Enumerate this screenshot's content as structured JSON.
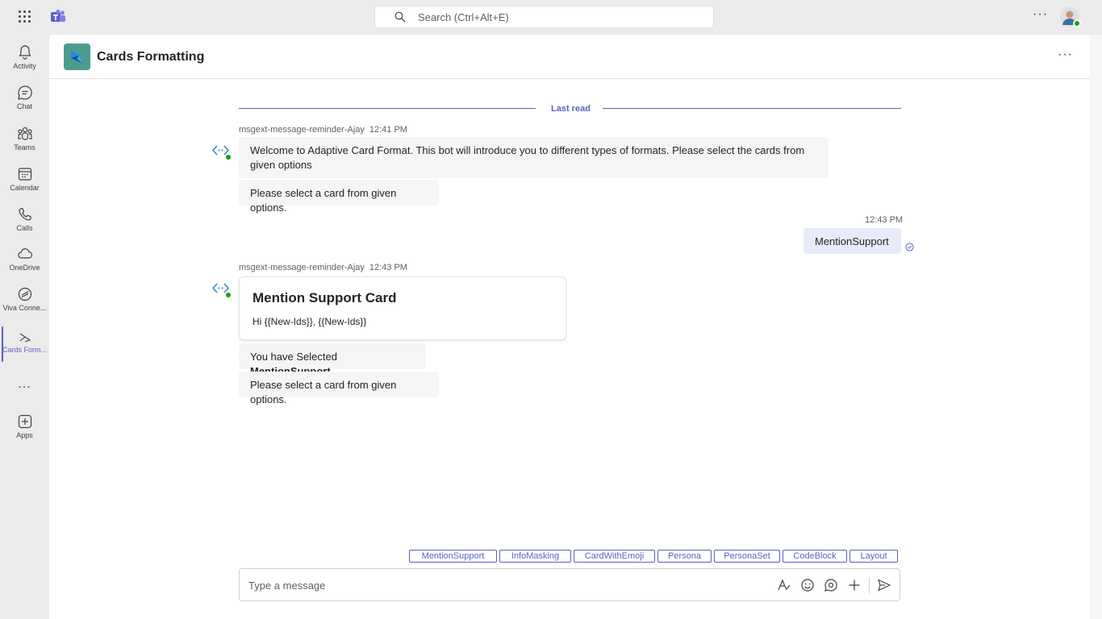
{
  "topbar": {
    "search_placeholder": "Search (Ctrl+Alt+E)"
  },
  "rail": {
    "items": [
      {
        "label": "Activity",
        "icon": "bell-icon"
      },
      {
        "label": "Chat",
        "icon": "chat-icon"
      },
      {
        "label": "Teams",
        "icon": "teams-icon"
      },
      {
        "label": "Calendar",
        "icon": "calendar-icon"
      },
      {
        "label": "Calls",
        "icon": "phone-icon"
      },
      {
        "label": "OneDrive",
        "icon": "cloud-icon"
      },
      {
        "label": "Viva Conne...",
        "icon": "viva-icon"
      },
      {
        "label": "Cards Form...",
        "icon": "cards-app-icon",
        "active": true
      },
      {
        "label": "Apps",
        "icon": "add-app-icon"
      }
    ],
    "more_label": "..."
  },
  "header": {
    "title": "Cards Formatting"
  },
  "conversation": {
    "last_read": "Last read",
    "messages": [
      {
        "sender": "msgext-message-reminder-Ajay",
        "time": "12:41 PM",
        "text1": "Welcome to Adaptive Card Format. This bot will introduce you to different types of formats. Please select the cards from given options",
        "text2": "Please select a card from given options."
      },
      {
        "time": "12:43 PM",
        "text": "MentionSupport"
      },
      {
        "sender": "msgext-message-reminder-Ajay",
        "time": "12:43 PM",
        "card_title": "Mention Support Card",
        "card_body": "Hi {{New-Ids}}, {{New-Ids}}",
        "selected_prefix": "You have Selected ",
        "selected_value": "MentionSupport",
        "text2": "Please select a card from given options."
      }
    ]
  },
  "suggestions": [
    "MentionSupport",
    "InfoMasking",
    "CardWithEmoji",
    "Persona",
    "PersonaSet",
    "CodeBlock",
    "Layout"
  ],
  "compose": {
    "placeholder": "Type a message"
  },
  "colors": {
    "accent": "#5b5fc7",
    "presence": "#13a10e",
    "app_icon_bg": "#4d9b8f"
  }
}
